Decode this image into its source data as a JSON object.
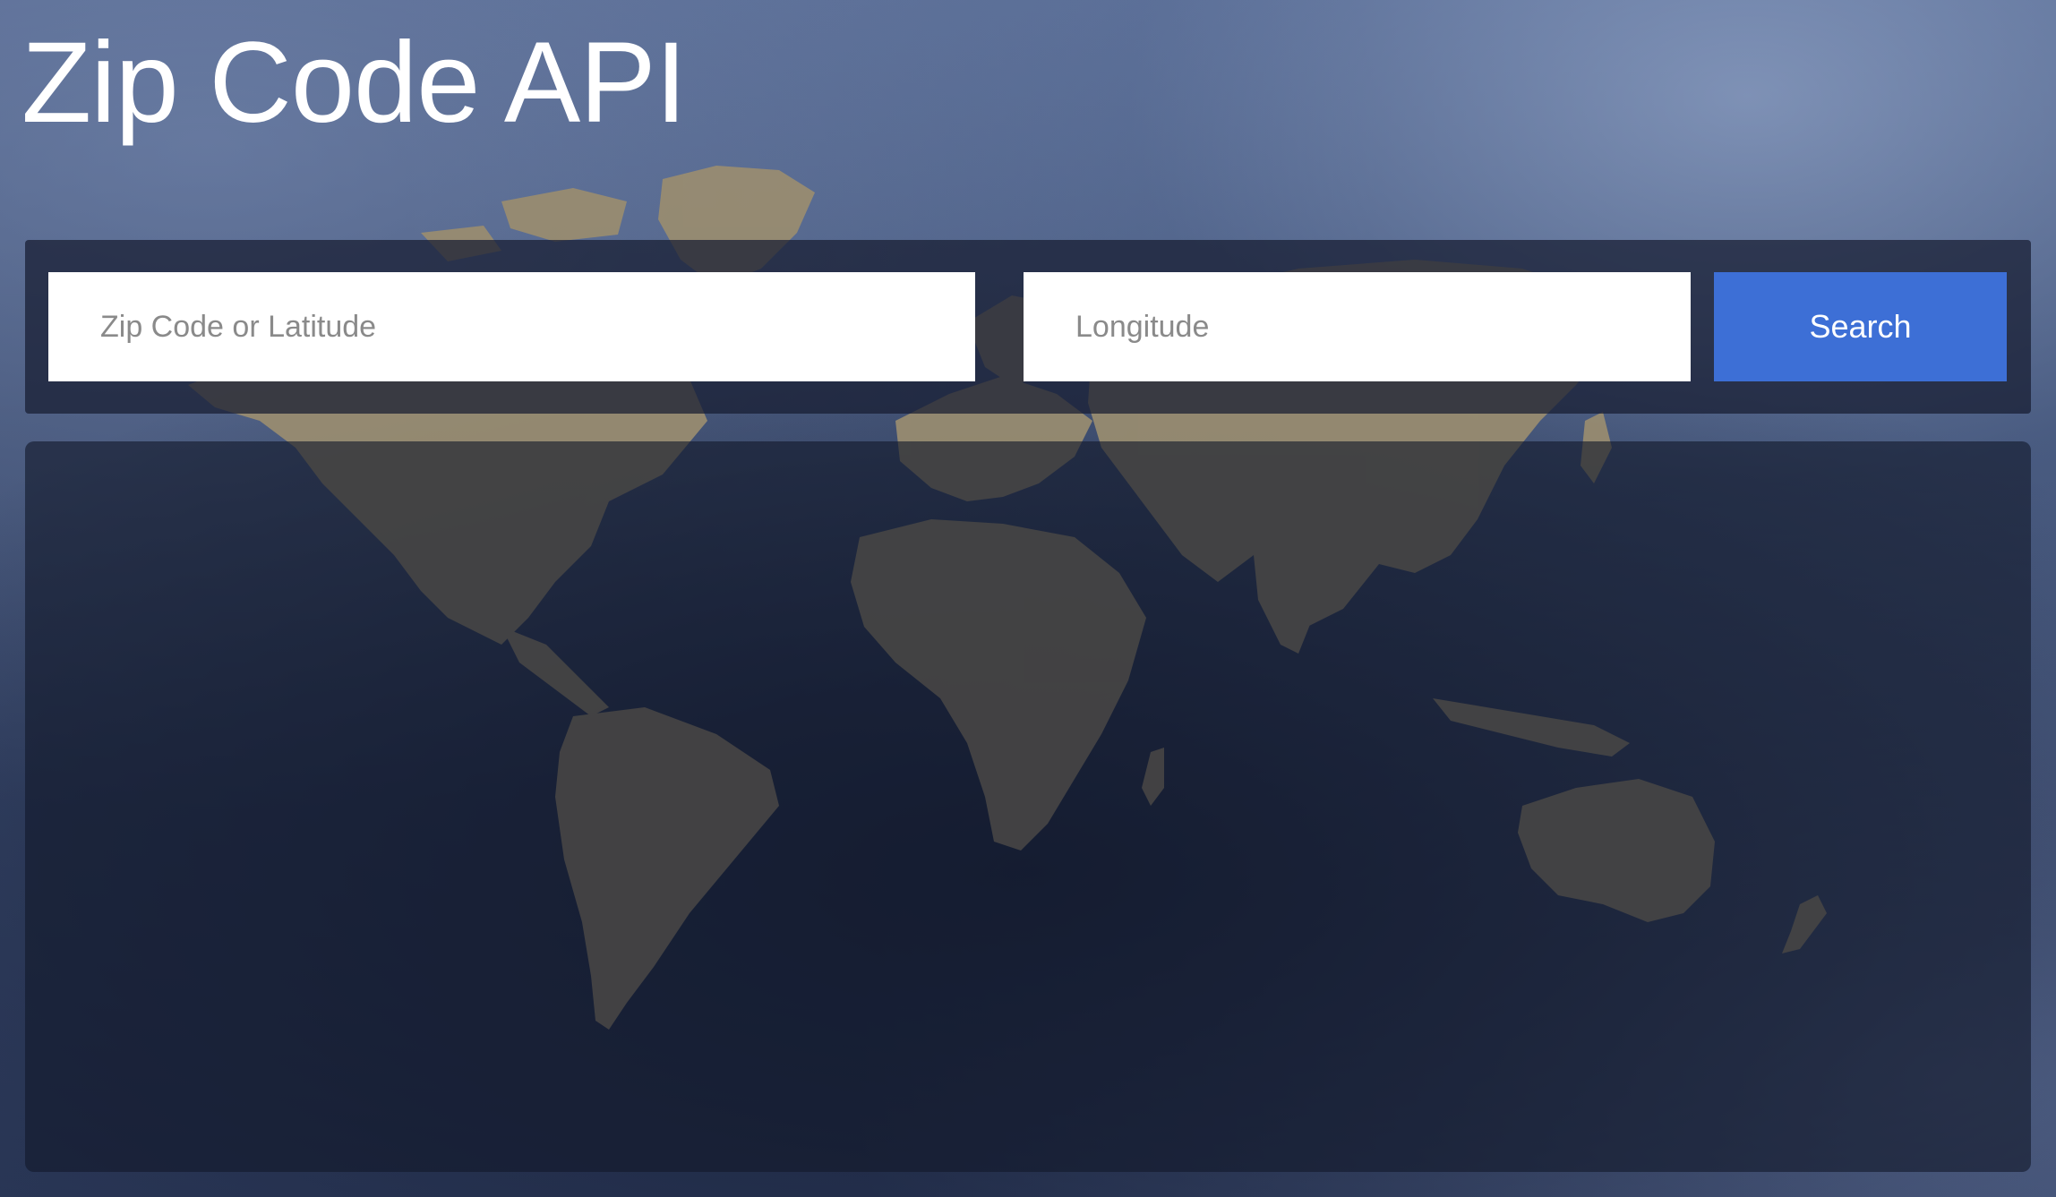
{
  "header": {
    "title": "Zip Code API"
  },
  "search": {
    "zip_placeholder": "Zip Code or Latitude",
    "zip_value": "",
    "longitude_placeholder": "Longitude",
    "longitude_value": "",
    "button_label": "Search"
  },
  "background": {
    "image": "world-map",
    "land_color": "#8c8066",
    "ocean_color": "#1c2540"
  },
  "colors": {
    "accent": "#3d6fd6",
    "title_text": "#ffffff"
  }
}
